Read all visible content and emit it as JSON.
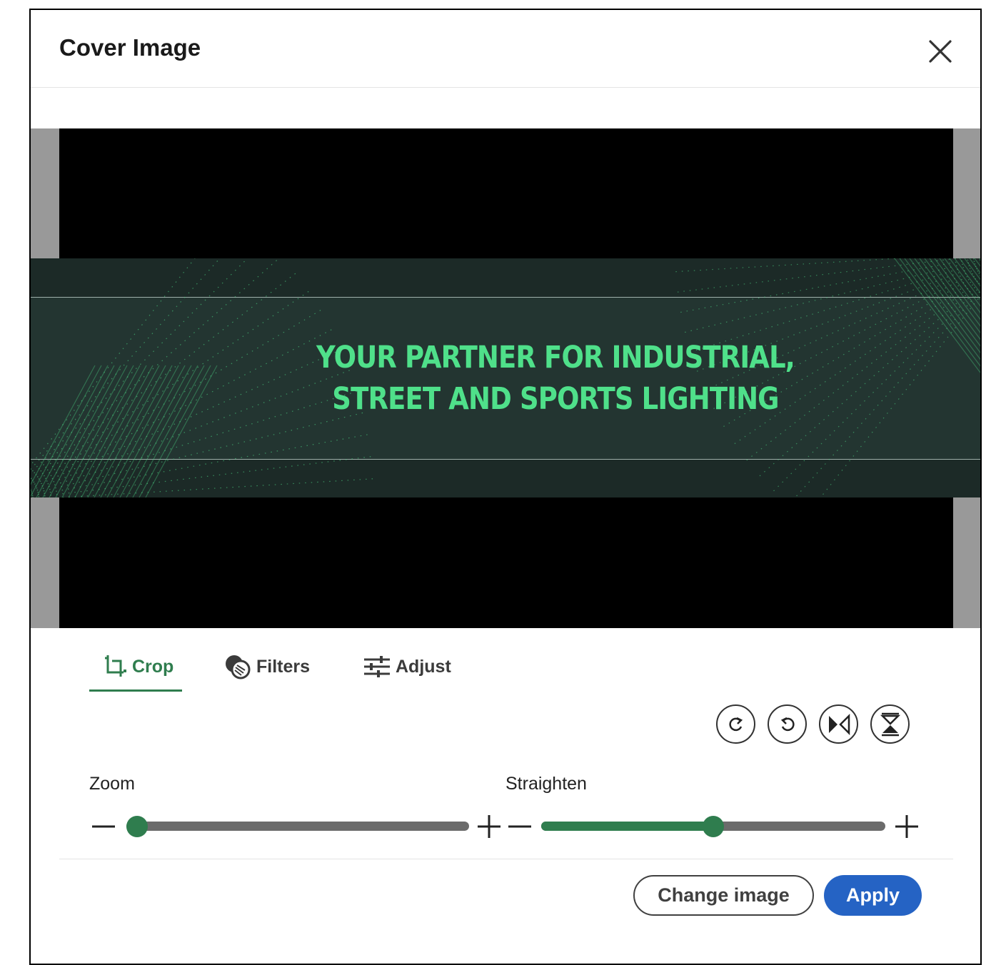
{
  "dialog": {
    "title": "Cover Image",
    "close_icon": "close-icon"
  },
  "banner": {
    "line1": "YOUR PARTNER FOR INDUSTRIAL,",
    "line2": "STREET AND SPORTS LIGHTING",
    "text_color": "#4fe08a",
    "background_color": "#233531"
  },
  "tabs": [
    {
      "label": "Crop",
      "icon": "crop-icon",
      "active": true
    },
    {
      "label": "Filters",
      "icon": "filters-icon",
      "active": false
    },
    {
      "label": "Adjust",
      "icon": "adjust-icon",
      "active": false
    }
  ],
  "tools": [
    {
      "icon": "rotate-clockwise-icon"
    },
    {
      "icon": "rotate-counterclockwise-icon"
    },
    {
      "icon": "flip-horizontal-icon"
    },
    {
      "icon": "flip-vertical-icon"
    }
  ],
  "sliders": {
    "zoom": {
      "label": "Zoom",
      "value_fraction": 0.0
    },
    "straighten": {
      "label": "Straighten",
      "value_fraction": 0.5
    }
  },
  "actions": {
    "change_image": "Change image",
    "apply": "Apply"
  },
  "colors": {
    "accent_green": "#2f7d4e",
    "primary_blue": "#2563c4"
  }
}
